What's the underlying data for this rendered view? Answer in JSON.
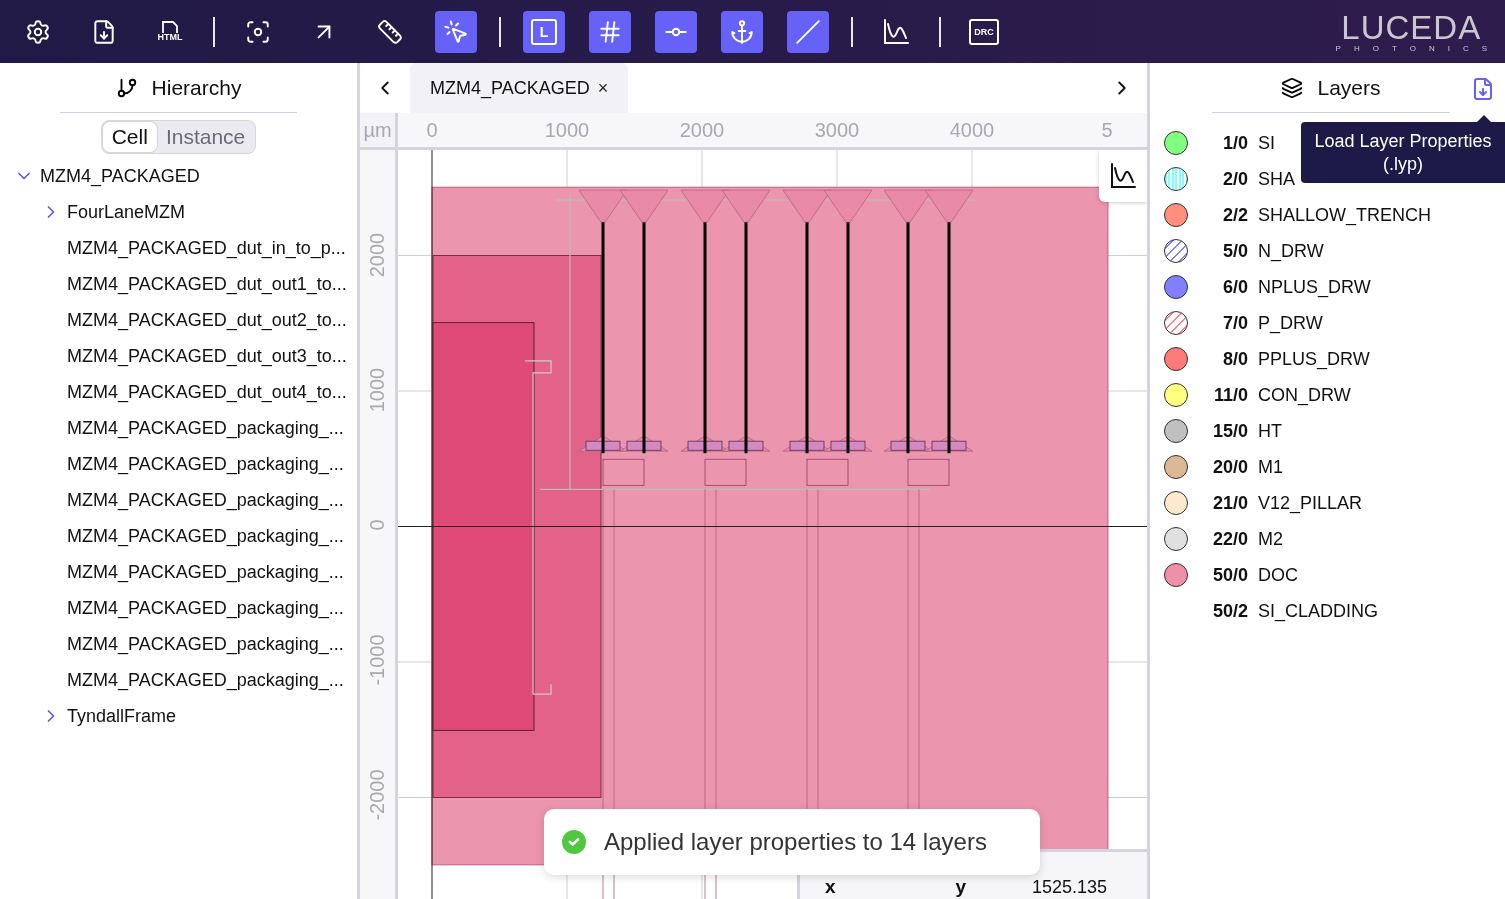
{
  "toolbar": {
    "groups": [
      [
        {
          "kind": "settings",
          "selected": false
        },
        {
          "kind": "download",
          "selected": false
        },
        {
          "kind": "html",
          "label": "HTML",
          "selected": false
        }
      ],
      [
        {
          "kind": "focus",
          "selected": false
        },
        {
          "kind": "arrow",
          "selected": false
        },
        {
          "kind": "ruler",
          "selected": false
        },
        {
          "kind": "select",
          "selected": true
        }
      ],
      [
        {
          "kind": "box",
          "label": "L",
          "selected": true
        },
        {
          "kind": "grid",
          "selected": true
        },
        {
          "kind": "node",
          "selected": true
        },
        {
          "kind": "anchor",
          "selected": true
        },
        {
          "kind": "line",
          "selected": true
        }
      ],
      [
        {
          "kind": "chart",
          "selected": false
        }
      ],
      [
        {
          "kind": "drc",
          "label": "DRC",
          "selected": false
        }
      ]
    ],
    "logo": {
      "name": "LUCEDA",
      "tagline": "PHOTONICS"
    }
  },
  "hierarchy": {
    "title": "Hierarchy",
    "modes": [
      {
        "label": "Cell",
        "selected": true
      },
      {
        "label": "Instance",
        "selected": false
      }
    ],
    "tree": [
      {
        "label": "MZM4_PACKAGED",
        "expanded": true,
        "children": [
          {
            "label": "FourLaneMZM",
            "expanded": false
          },
          {
            "label": "MZM4_PACKAGED_dut_in_to_p..."
          },
          {
            "label": "MZM4_PACKAGED_dut_out1_to..."
          },
          {
            "label": "MZM4_PACKAGED_dut_out2_to..."
          },
          {
            "label": "MZM4_PACKAGED_dut_out3_to..."
          },
          {
            "label": "MZM4_PACKAGED_dut_out4_to..."
          },
          {
            "label": "MZM4_PACKAGED_packaging_..."
          },
          {
            "label": "MZM4_PACKAGED_packaging_..."
          },
          {
            "label": "MZM4_PACKAGED_packaging_..."
          },
          {
            "label": "MZM4_PACKAGED_packaging_..."
          },
          {
            "label": "MZM4_PACKAGED_packaging_..."
          },
          {
            "label": "MZM4_PACKAGED_packaging_..."
          },
          {
            "label": "MZM4_PACKAGED_packaging_..."
          },
          {
            "label": "MZM4_PACKAGED_packaging_..."
          },
          {
            "label": "TyndallFrame",
            "expanded": false
          }
        ]
      }
    ]
  },
  "canvas": {
    "tabs": [
      {
        "label": "MZM4_PACKAGED",
        "selected": true,
        "close": "×"
      }
    ],
    "unit": "µm",
    "x_ruler": [
      "0",
      "1000",
      "2000",
      "3000",
      "4000",
      "5"
    ],
    "y_ruler": [
      "2000",
      "1000",
      "0",
      "-1000",
      "-2000"
    ],
    "coordinates": {
      "x_label": "x",
      "y_label": "y",
      "y_value": "1525.135"
    },
    "toast": {
      "message": "Applied layer properties to 14 layers"
    }
  },
  "layers": {
    "title": "Layers",
    "tooltip": "Load Layer Properties (.lyp)",
    "items": [
      {
        "number": "1/0",
        "name": "SI",
        "kind": "solid",
        "color": "#80ff80"
      },
      {
        "number": "2/0",
        "name": "SHA",
        "kind": "stripes",
        "color": "#80ffff"
      },
      {
        "number": "2/2",
        "name": "SHALLOW_TRENCH",
        "kind": "solid",
        "color": "#ff9080"
      },
      {
        "number": "5/0",
        "name": "N_DRW",
        "kind": "hatch",
        "color": "#8080ff"
      },
      {
        "number": "6/0",
        "name": "NPLUS_DRW",
        "kind": "solid",
        "color": "#8080ff"
      },
      {
        "number": "7/0",
        "name": "P_DRW",
        "kind": "hatch",
        "color": "#ff8080"
      },
      {
        "number": "8/0",
        "name": "PPLUS_DRW",
        "kind": "solid",
        "color": "#ff7b7b"
      },
      {
        "number": "11/0",
        "name": "CON_DRW",
        "kind": "solid",
        "color": "#ffff80"
      },
      {
        "number": "15/0",
        "name": "HT",
        "kind": "solid",
        "color": "#c0c0c0"
      },
      {
        "number": "20/0",
        "name": "M1",
        "kind": "solid",
        "color": "#dcb894"
      },
      {
        "number": "21/0",
        "name": "V12_PILLAR",
        "kind": "solid",
        "color": "#ffe9cc"
      },
      {
        "number": "22/0",
        "name": "M2",
        "kind": "solid",
        "color": "#e0e0e0"
      },
      {
        "number": "50/0",
        "name": "DOC",
        "kind": "solid",
        "color": "#f090a8"
      },
      {
        "number": "50/2",
        "name": "SI_CLADDING",
        "kind": "none"
      }
    ]
  }
}
